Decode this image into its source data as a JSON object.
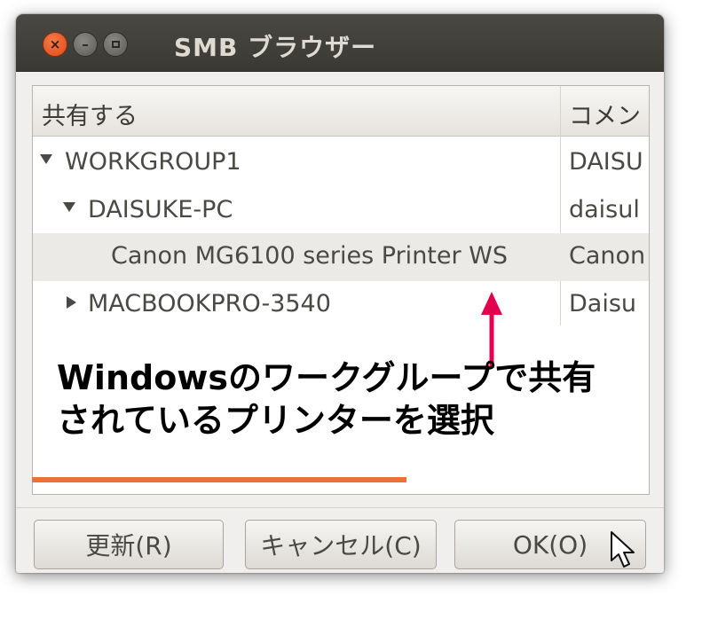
{
  "window": {
    "title": "SMB ブラウザー"
  },
  "columns": [
    "共有する",
    "コメン"
  ],
  "tree": [
    {
      "label": "WORKGROUP1",
      "comment": "DAISU",
      "expander": "expanded"
    },
    {
      "label": "DAISUKE-PC",
      "comment": "daisul",
      "expander": "expanded"
    },
    {
      "label": "Canon MG6100 series Printer WS",
      "comment": "Canon",
      "selected": true
    },
    {
      "label": "MACBOOKPRO-3540",
      "comment": "Daisu",
      "expander": "collapsed"
    }
  ],
  "annotation": {
    "line1": "Windowsのワークグループで共有",
    "line2": "されているプリンターを選択",
    "arrow_color": "#e3004f"
  },
  "buttons": {
    "refresh": "更新(R)",
    "cancel": "キャンセル(C)",
    "ok": "OK(O)"
  },
  "colors": {
    "accent": "#e8733e",
    "titlebar": "#3c3b37",
    "close": "#df4b16"
  },
  "icons": [
    "close-icon",
    "minimize-icon",
    "maximize-icon",
    "expand-down-icon",
    "expand-right-icon",
    "arrow-up-icon",
    "mouse-pointer-icon"
  ]
}
